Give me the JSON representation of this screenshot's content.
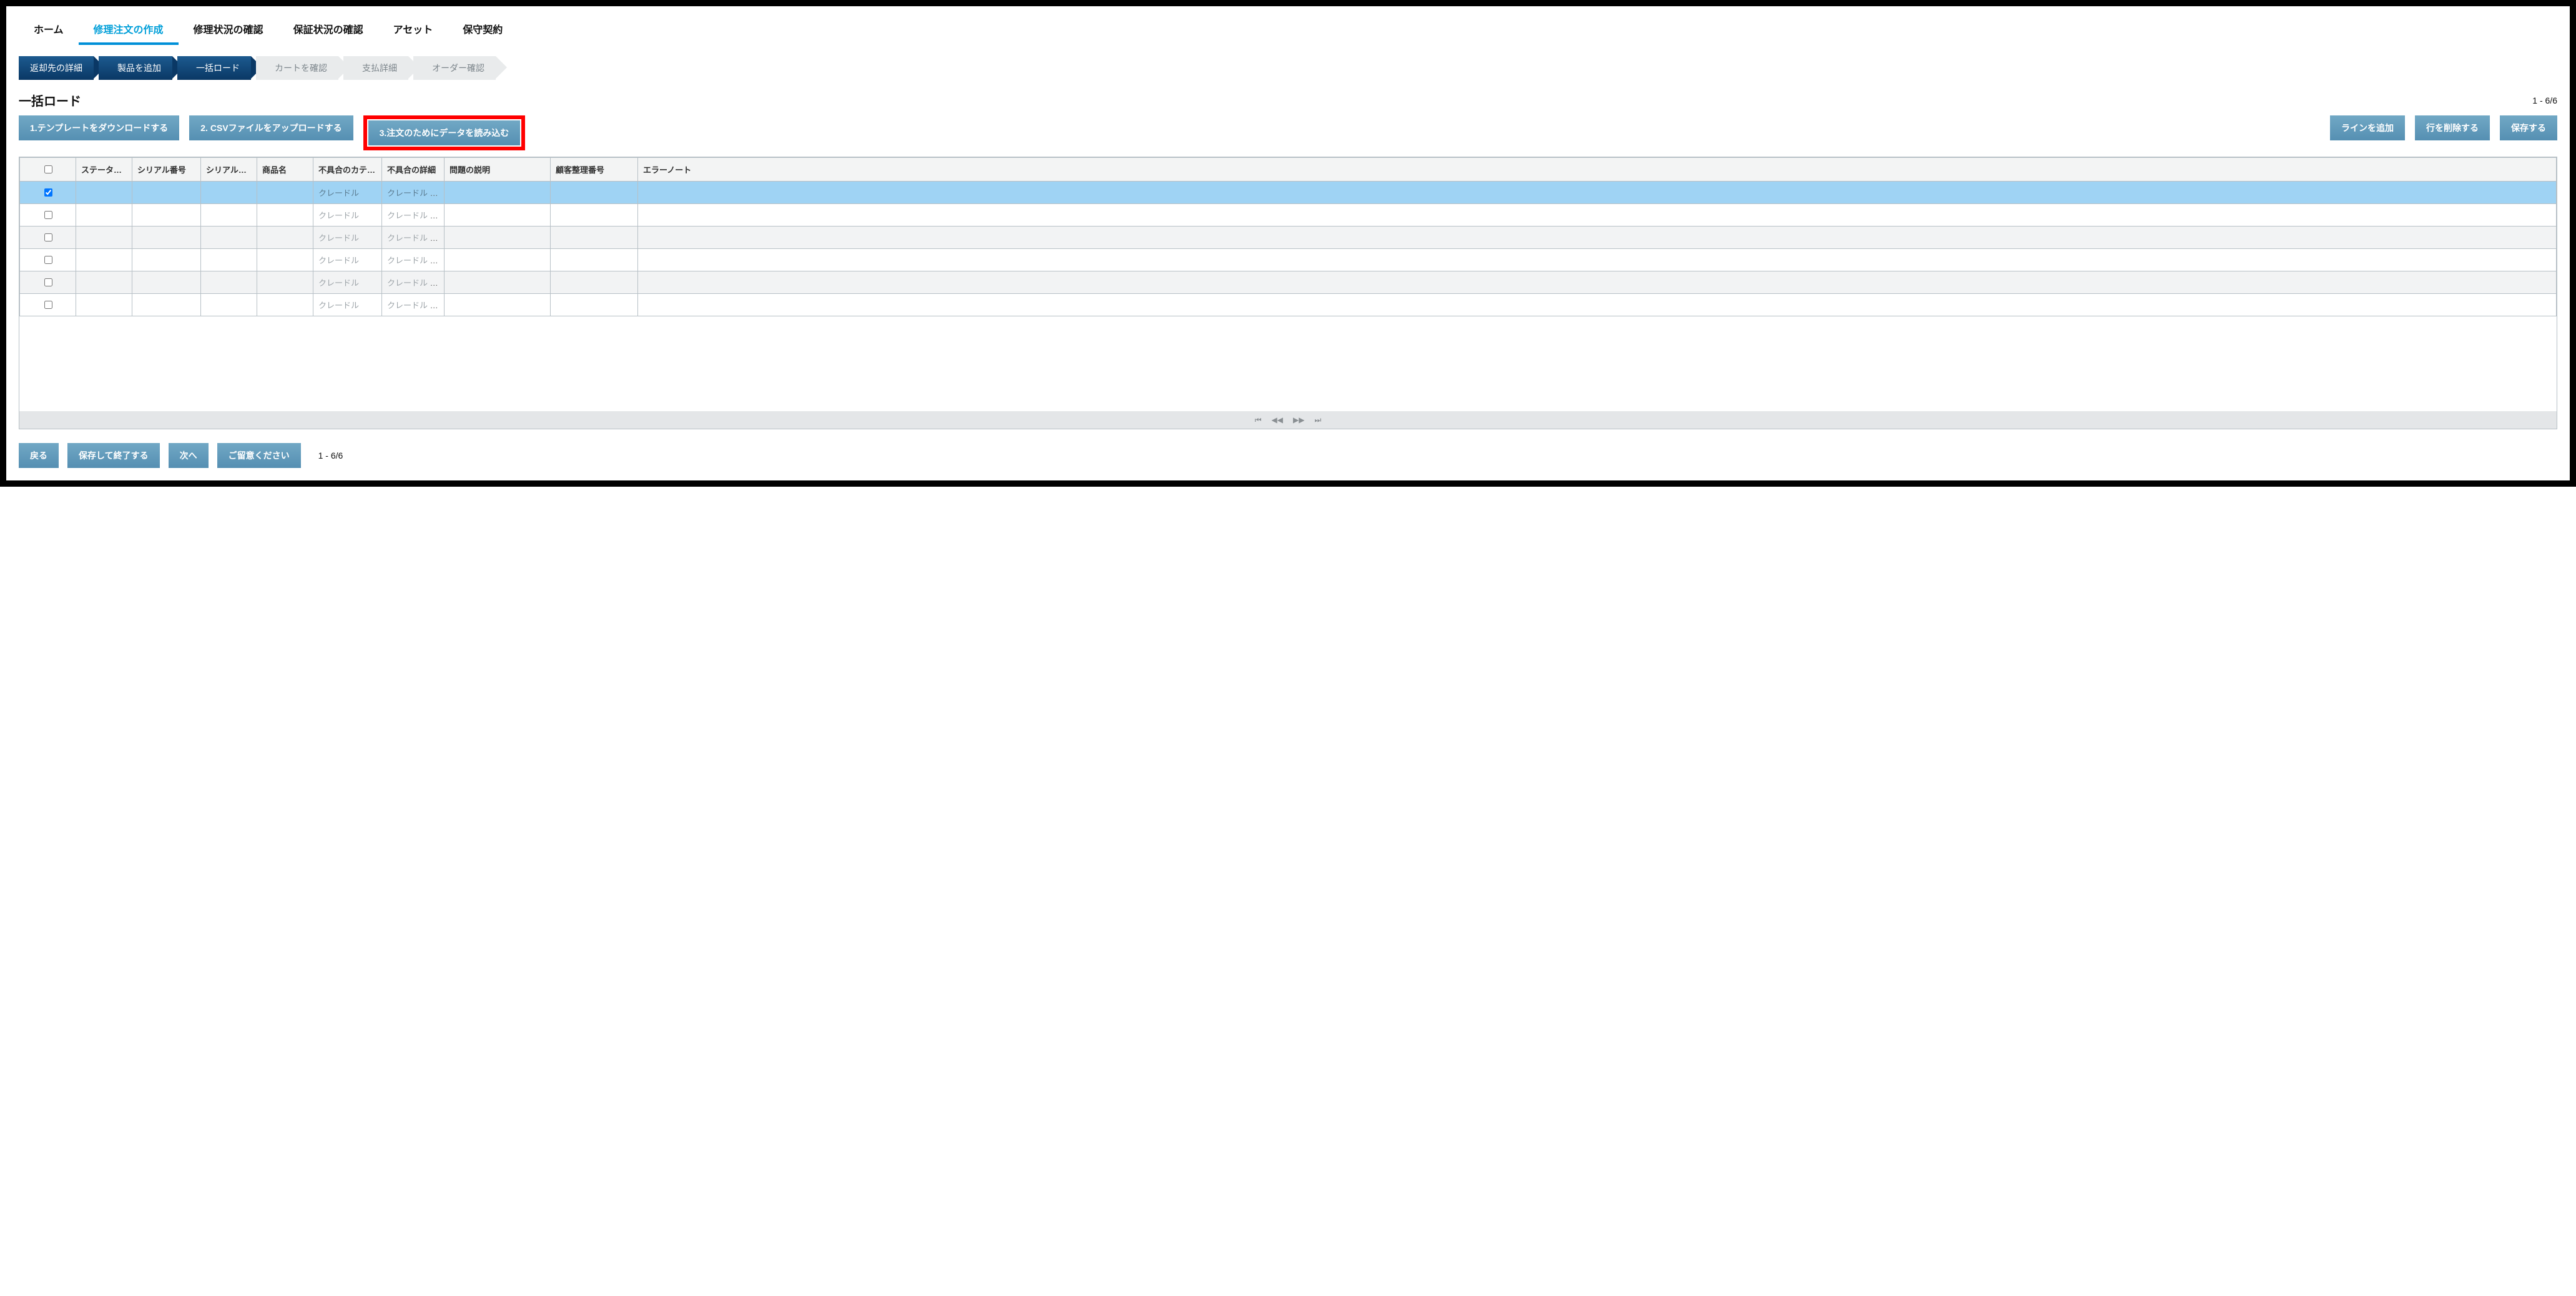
{
  "tabs": {
    "home": "ホーム",
    "create_repair": "修理注文の作成",
    "repair_status": "修理状況の確認",
    "warranty_status": "保証状況の確認",
    "asset": "アセット",
    "maint_contract": "保守契約"
  },
  "steps": {
    "return_detail": "返却先の詳細",
    "add_product": "製品を追加",
    "bulk_load": "一括ロード",
    "review_cart": "カートを確認",
    "payment": "支払詳細",
    "order_confirm": "オーダー確認"
  },
  "section": {
    "title": "一括ロード",
    "range_top": "1 - 6/6",
    "range_bottom": "1 - 6/6"
  },
  "buttons": {
    "dl_template": "1.テンプレートをダウンロードする",
    "upload_csv": "2. CSVファイルをアップロードする",
    "load_for_order": "3.注文のためにデータを読み込む",
    "add_line": "ラインを追加",
    "delete_row": "行を削除する",
    "save": "保存する",
    "back": "戻る",
    "save_exit": "保存して終了する",
    "next": "次へ",
    "please_note": "ご留意ください"
  },
  "table": {
    "headers": {
      "status_flag": "ステータス フラグを",
      "serial_no": "シリアル番号",
      "has_serial": "シリアル番号があり",
      "product_name": "商品名",
      "defect_cat": "不具合のカテゴリー",
      "defect_detail": "不具合の詳細",
      "issue_desc": "問題の説明",
      "cust_ref_no": "顧客整理番号",
      "error_note": "エラーノート"
    },
    "rows": [
      {
        "checked": true,
        "status_flag": "",
        "serial_no": "",
        "has_serial": "",
        "product_name": "",
        "defect_cat": "クレードル",
        "defect_detail": "クレードル – イ...",
        "issue_desc": "",
        "cust_ref_no": "",
        "error_note": ""
      },
      {
        "checked": false,
        "status_flag": "",
        "serial_no": "",
        "has_serial": "",
        "product_name": "",
        "defect_cat": "クレードル",
        "defect_detail": "クレードル – イ...",
        "issue_desc": "",
        "cust_ref_no": "",
        "error_note": ""
      },
      {
        "checked": false,
        "status_flag": "",
        "serial_no": "",
        "has_serial": "",
        "product_name": "",
        "defect_cat": "クレードル",
        "defect_detail": "クレードル – イ...",
        "issue_desc": "",
        "cust_ref_no": "",
        "error_note": ""
      },
      {
        "checked": false,
        "status_flag": "",
        "serial_no": "",
        "has_serial": "",
        "product_name": "",
        "defect_cat": "クレードル",
        "defect_detail": "クレードル – イ...",
        "issue_desc": "",
        "cust_ref_no": "",
        "error_note": ""
      },
      {
        "checked": false,
        "status_flag": "",
        "serial_no": "",
        "has_serial": "",
        "product_name": "",
        "defect_cat": "クレードル",
        "defect_detail": "クレードル – イ...",
        "issue_desc": "",
        "cust_ref_no": "",
        "error_note": ""
      },
      {
        "checked": false,
        "status_flag": "",
        "serial_no": "",
        "has_serial": "",
        "product_name": "",
        "defect_cat": "クレードル",
        "defect_detail": "クレードル – イ...",
        "issue_desc": "",
        "cust_ref_no": "",
        "error_note": ""
      }
    ]
  },
  "pager_icons": {
    "first": "⏮",
    "prev": "◀◀",
    "next": "▶▶",
    "last": "⏭"
  }
}
